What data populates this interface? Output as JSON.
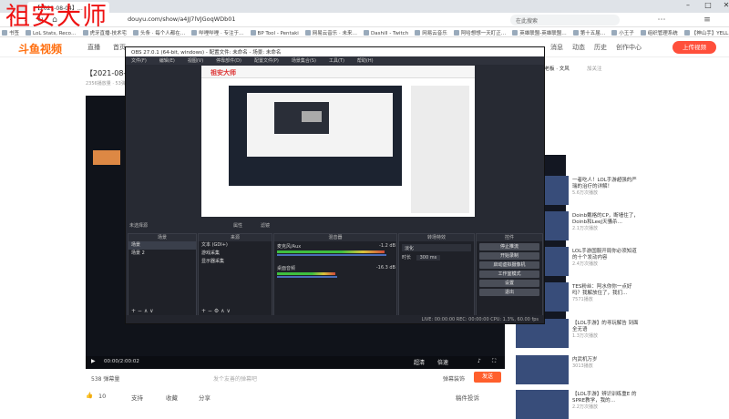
{
  "browser": {
    "tab_title": "【2021-08-04】…",
    "url": "douyu.com/show/a4JJ7lVJGoqWDb01",
    "search_placeholder": "在此搜索",
    "bookmarks": [
      "书签",
      "LoL Stats, Reco…",
      "虎牙直播-技术宅",
      "头条 · 每个人都在…",
      "哔哩哔哩 · 专注于…",
      "BP Tool - Pentaki",
      "网易云音乐 · 未来…",
      "Dashill - Twitch",
      "网易云音乐",
      "阿哈想想一天盯正…",
      "英雄联盟-英雄联盟…",
      "第十五届…",
      "小王子",
      "组织管理系统",
      "【神山手】YELL…",
      "【神山手】YELL…"
    ]
  },
  "site": {
    "logo": "斗鱼视频",
    "nav": [
      "直播",
      "首页"
    ],
    "right_nav": [
      "消息",
      "动态",
      "历史",
      "创作中心"
    ],
    "upload_label": "上传视频",
    "video_title": "【2021-08-04】…",
    "meta": "2356播放量 · 53弹幕 · 2021-08-04 23:49",
    "player_time": "00:00/2:00:02",
    "quality": "超清",
    "speed": "倍速",
    "actions": {
      "danmaku_count": "538 弹幕量",
      "danmaku_placeholder": "发个友善的弹幕吧",
      "danmaku_setting": "弹幕装饰",
      "send": "发送"
    },
    "likes": {
      "like_count": "10",
      "support": "支持",
      "collect": "收藏",
      "share": "分享",
      "report": "稿件投诉"
    }
  },
  "sidebar": {
    "author": "小老板 · 文风",
    "follow": "加关注",
    "recommend": [
      {
        "title": "一者吃人！LOL手游超强的严瑞的治疗的详解！",
        "info": "5.6万次播放"
      },
      {
        "title": "Doinb戴格的CP，断墙住了，Doinb和LeeJ天骚杀…",
        "info": "2.1万次播放"
      },
      {
        "title": "LOL手游国服开局你必须知道的十个发动内容",
        "info": "2.4万次播放"
      },
      {
        "title": "TES粉丝：阿水你你一点好吗？我解放住了，我们…",
        "info": "7571播放"
      },
      {
        "title": "【LOL手游】的寻玩解告 到面全无语",
        "info": "1.3万次播放"
      },
      {
        "title": "内武机万岁",
        "info": "3013播放"
      },
      {
        "title": "【LOL手游】辨识训练重E 的SPRE教学，我的…",
        "info": "2.2万次播放"
      }
    ]
  },
  "obs": {
    "title": "OBS 27.0.1 (64-bit, windows) - 配置文件: 未命名 - 场景: 未命名",
    "menu": [
      "文件(F)",
      "编辑(E)",
      "视图(V)",
      "停靠部件(D)",
      "配置文件(P)",
      "场景集合(S)",
      "工具(T)",
      "帮助(H)"
    ],
    "no_source": "未选择源",
    "properties": "属性",
    "filters": "滤镜",
    "panels": {
      "scenes": "场景",
      "sources": "来源",
      "mixer": "混音器",
      "transitions": "转场特效",
      "controls": "控件"
    },
    "scenes_list": [
      "场景",
      "场景 2"
    ],
    "sources_list": [
      "文本 (GDI+)",
      "游戏采集",
      "显示器采集"
    ],
    "mixer": [
      {
        "name": "麦克风/Aux",
        "db": "-1.2 dB"
      },
      {
        "name": "桌面音频",
        "db": "-16.3 dB"
      }
    ],
    "transition": {
      "type": "淡化",
      "duration_label": "时长",
      "duration": "300 ms"
    },
    "control_buttons": [
      "停止推流",
      "开始录制",
      "启动虚拟摄像机",
      "工作室模式",
      "设置",
      "退出"
    ],
    "status": "LIVE: 00:00:00   REC: 00:00:00   CPU: 1.3%, 60.00 fps",
    "watermark": "祖安大师"
  },
  "overlay_watermark": "祖安大师"
}
